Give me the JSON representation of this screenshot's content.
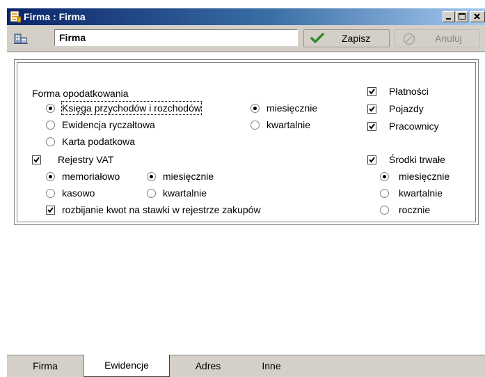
{
  "window": {
    "title": "Firma : Firma"
  },
  "toolbar": {
    "name_value": "Firma",
    "save_label": "Zapisz",
    "cancel_label": "Anuluj"
  },
  "form": {
    "taxation": {
      "title": "Forma opodatkowania",
      "options": [
        "Księga przychodów i rozchodów",
        "Ewidencja ryczałtowa",
        "Karta podatkowa"
      ],
      "selected": "Księga przychodów i rozchodów",
      "period_options": [
        "miesięcznie",
        "kwartalnie"
      ],
      "period_selected": "miesięcznie"
    },
    "modules": {
      "payments": {
        "label": "Płatności",
        "checked": true
      },
      "vehicles": {
        "label": "Pojazdy",
        "checked": true
      },
      "employees": {
        "label": "Pracownicy",
        "checked": true
      }
    },
    "vat": {
      "label": "Rejestry VAT",
      "checked": true,
      "method_options": [
        "memoriałowo",
        "kasowo"
      ],
      "method_selected": "memoriałowo",
      "period_options": [
        "miesięcznie",
        "kwartalnie"
      ],
      "period_selected": "miesięcznie",
      "split_label": "rozbijanie kwot na stawki w rejestrze zakupów",
      "split_checked": true
    },
    "fixed_assets": {
      "label": "Środki trwałe",
      "checked": true,
      "period_options": [
        "miesięcznie",
        "kwartalnie",
        "rocznie"
      ],
      "period_selected": "miesięcznie"
    }
  },
  "tabs": [
    {
      "label": "Firma",
      "active": false
    },
    {
      "label": "Ewidencje",
      "active": true
    },
    {
      "label": "Adres",
      "active": false
    },
    {
      "label": "Inne",
      "active": false
    }
  ],
  "colors": {
    "title_start": "#0a246a",
    "title_end": "#a6caf0",
    "check_green": "#2e8b2e",
    "face": "#d4d0c8"
  }
}
